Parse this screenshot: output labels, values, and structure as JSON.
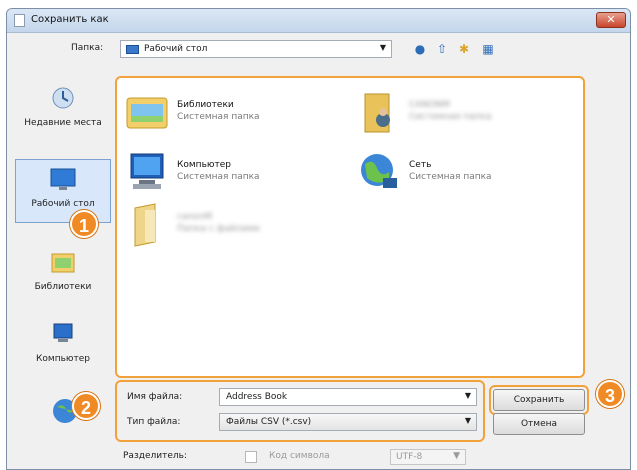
{
  "window": {
    "title": "Сохранить как",
    "close_glyph": "✕"
  },
  "folder_bar": {
    "label": "Папка:",
    "current_folder": "Рабочий стол"
  },
  "places": [
    {
      "label": "Недавние места",
      "icon": "recent-places-icon"
    },
    {
      "label": "Рабочий стол",
      "icon": "desktop-icon"
    },
    {
      "label": "Библиотеки",
      "icon": "libraries-icon"
    },
    {
      "label": "Компьютер",
      "icon": "computer-icon"
    }
  ],
  "items": [
    {
      "name": "Библиотеки",
      "type": "Системная папка",
      "icon": "libraries-folder-icon"
    },
    {
      "name": "CANONM",
      "type": "Системная папка",
      "icon": "user-folder-icon"
    },
    {
      "name": "Компьютер",
      "type": "Системная папка",
      "icon": "computer-icon"
    },
    {
      "name": "Сеть",
      "type": "Системная папка",
      "icon": "network-icon"
    },
    {
      "name": "canonM",
      "type": "Папка с файлами",
      "icon": "folder-icon"
    }
  ],
  "form": {
    "filename_label": "Имя файла:",
    "filename_value": "Address Book",
    "filetype_label": "Тип файла:",
    "filetype_value": "Файлы CSV (*.csv)"
  },
  "buttons": {
    "save": "Сохранить",
    "cancel": "Отмена"
  },
  "bottom": {
    "separator_label": "Разделитель:",
    "code_label": "Код символа",
    "encoding_value": "UTF-8"
  },
  "callouts": [
    "1",
    "2",
    "3"
  ],
  "colors": {
    "callout": "#f08a24",
    "highlight_border": "#f2a23a"
  }
}
